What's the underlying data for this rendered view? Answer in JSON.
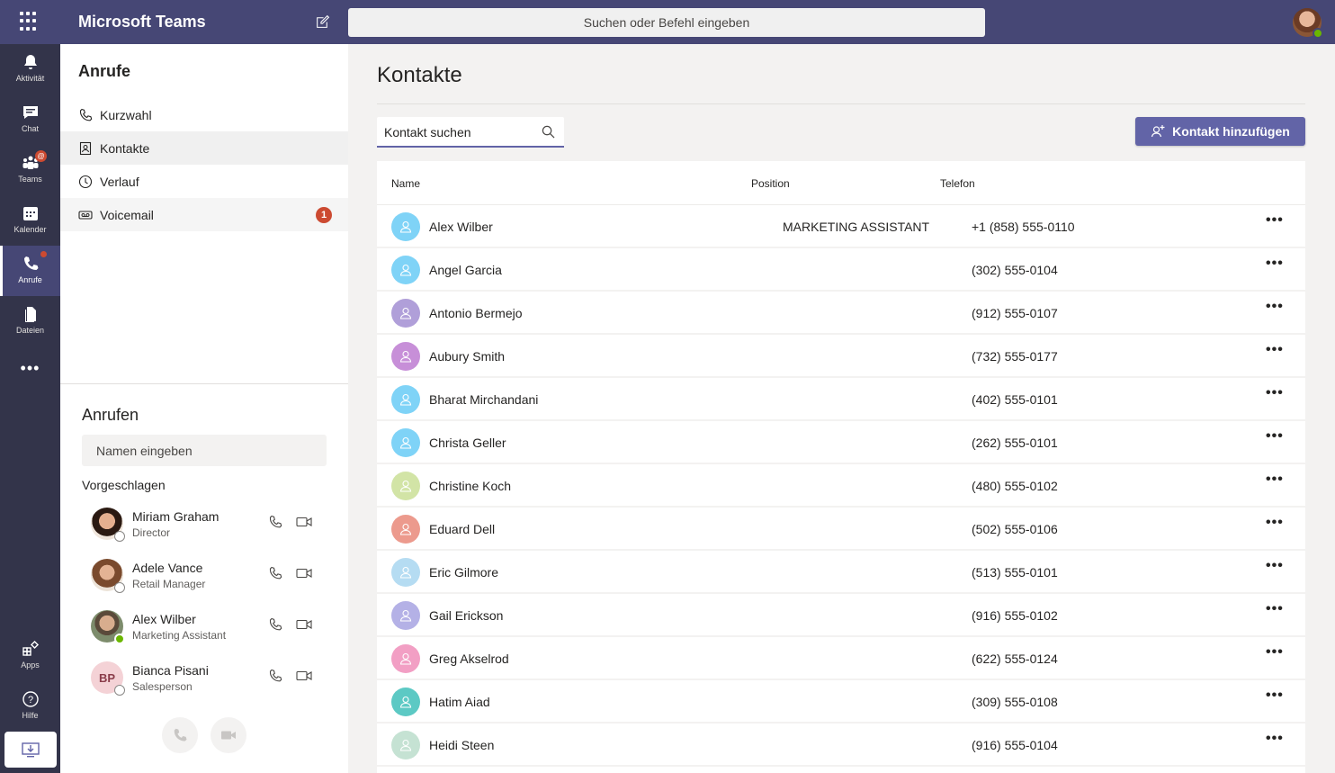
{
  "header": {
    "app_title": "Microsoft Teams",
    "search_placeholder": "Suchen oder Befehl eingeben"
  },
  "rail": {
    "items": [
      {
        "label": "Aktivität",
        "icon": "bell-icon"
      },
      {
        "label": "Chat",
        "icon": "chat-icon"
      },
      {
        "label": "Teams",
        "icon": "teams-icon",
        "badge": "@"
      },
      {
        "label": "Kalender",
        "icon": "calendar-icon"
      },
      {
        "label": "Anrufe",
        "icon": "phone-icon",
        "active": true
      },
      {
        "label": "Dateien",
        "icon": "file-icon"
      }
    ],
    "more": "•••",
    "bottom": [
      {
        "label": "Apps",
        "icon": "apps-icon"
      },
      {
        "label": "Hilfe",
        "icon": "help-icon"
      }
    ]
  },
  "calls_panel": {
    "title": "Anrufe",
    "nav": [
      {
        "label": "Kurzwahl",
        "icon": "phone-icon"
      },
      {
        "label": "Kontakte",
        "icon": "contacts-icon",
        "selected": true
      },
      {
        "label": "Verlauf",
        "icon": "clock-icon"
      },
      {
        "label": "Voicemail",
        "icon": "voicemail-icon",
        "badge": "1"
      }
    ],
    "dial_title": "Anrufen",
    "name_placeholder": "Namen eingeben",
    "suggested_title": "Vorgeschlagen",
    "suggested": [
      {
        "name": "Miriam Graham",
        "role": "Director",
        "status": "offline"
      },
      {
        "name": "Adele Vance",
        "role": "Retail Manager",
        "status": "offline"
      },
      {
        "name": "Alex Wilber",
        "role": "Marketing Assistant",
        "status": "available"
      },
      {
        "name": "Bianca Pisani",
        "role": "Salesperson",
        "initials": "BP",
        "status": "offline"
      }
    ]
  },
  "contacts": {
    "title": "Kontakte",
    "search_placeholder": "Kontakt suchen",
    "add_button": "Kontakt hinzufügen",
    "columns": {
      "name": "Name",
      "position": "Position",
      "phone": "Telefon"
    },
    "rows": [
      {
        "name": "Alex Wilber",
        "position": "MARKETING ASSISTANT",
        "phone": "+1 (858) 555-0110",
        "color": "#7fd3f7"
      },
      {
        "name": "Angel Garcia",
        "position": "",
        "phone": "(302) 555-0104",
        "color": "#7fd3f7"
      },
      {
        "name": "Antonio Bermejo",
        "position": "",
        "phone": "(912) 555-0107",
        "color": "#b09fd9"
      },
      {
        "name": "Aubury Smith",
        "position": "",
        "phone": "(732) 555-0177",
        "color": "#c78fd8"
      },
      {
        "name": "Bharat Mirchandani",
        "position": "",
        "phone": "(402) 555-0101",
        "color": "#7fd3f7"
      },
      {
        "name": "Christa Geller",
        "position": "",
        "phone": "(262) 555-0101",
        "color": "#7fd3f7"
      },
      {
        "name": "Christine Koch",
        "position": "",
        "phone": "(480) 555-0102",
        "color": "#d2e4a6"
      },
      {
        "name": "Eduard Dell",
        "position": "",
        "phone": "(502) 555-0106",
        "color": "#ec9a8d"
      },
      {
        "name": "Eric Gilmore",
        "position": "",
        "phone": "(513) 555-0101",
        "color": "#b5dcf2"
      },
      {
        "name": "Gail Erickson",
        "position": "",
        "phone": "(916) 555-0102",
        "color": "#b4b1e6"
      },
      {
        "name": "Greg Akselrod",
        "position": "",
        "phone": "(622) 555-0124",
        "color": "#f29fc4"
      },
      {
        "name": "Hatim Aiad",
        "position": "",
        "phone": "(309) 555-0108",
        "color": "#5cc9c4"
      },
      {
        "name": "Heidi Steen",
        "position": "",
        "phone": "(916) 555-0104",
        "color": "#c5e2d3"
      }
    ],
    "more": "•••"
  }
}
